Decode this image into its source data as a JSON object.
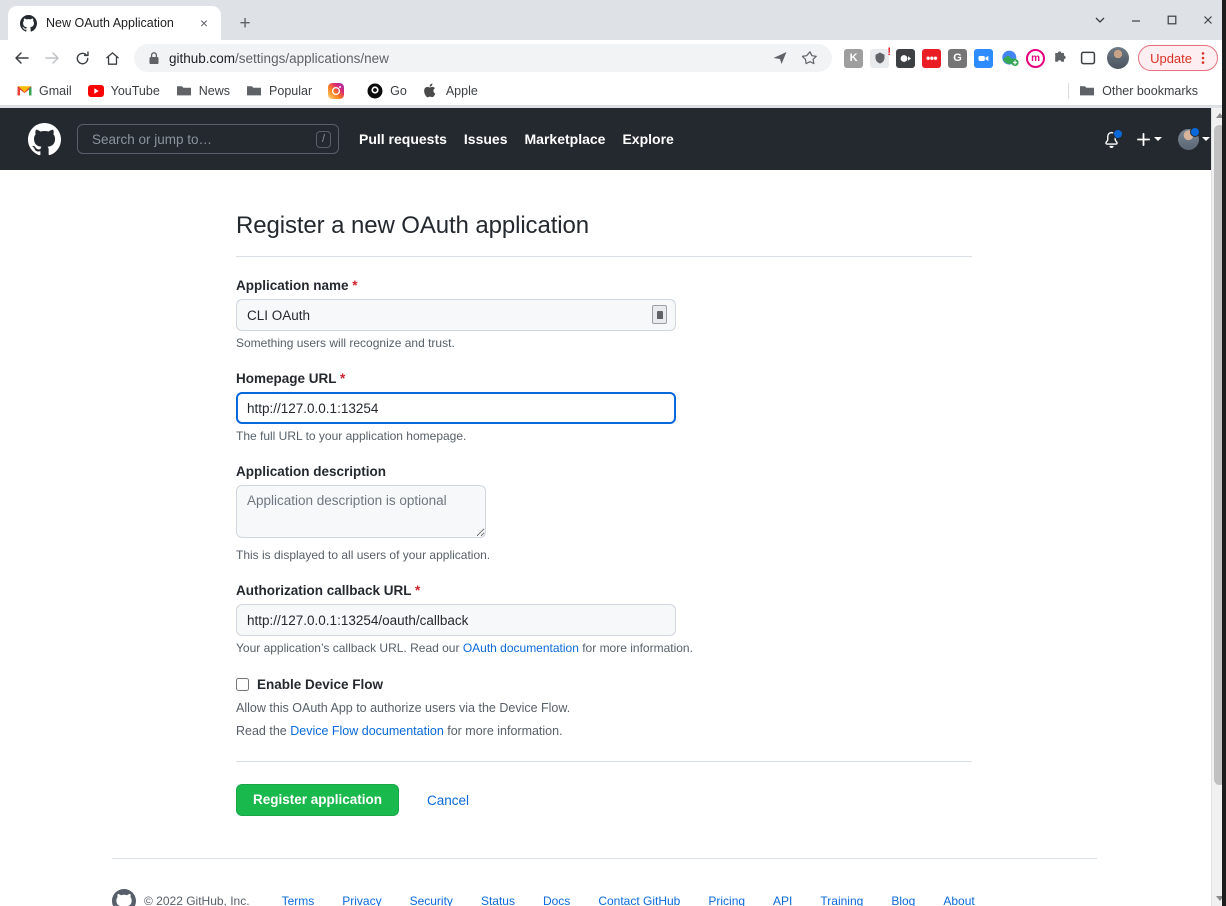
{
  "browser": {
    "tab": {
      "title": "New OAuth Application",
      "favicon": "github-icon",
      "close": "×"
    },
    "new_tab_label": "+",
    "window_controls": {
      "tab_search": "chevron-down-icon",
      "minimize": "minimize-icon",
      "maximize": "maximize-icon",
      "close": "close-icon"
    },
    "nav": {
      "back": "back-arrow-icon",
      "forward": "forward-arrow-icon",
      "reload": "reload-icon",
      "home": "home-icon"
    },
    "omnibox": {
      "lock": "lock-icon",
      "host": "github.com",
      "path": "/settings/applications/new",
      "share": "share-icon",
      "bookmark": "star-icon"
    },
    "extensions": [
      {
        "name": "kami-extension",
        "label": "K",
        "color": "#9e9e9e"
      },
      {
        "name": "grammar-extension",
        "label": "",
        "color": "#5f6368"
      },
      {
        "name": "screen-recorder-extension",
        "label": "",
        "color": "#3c4043"
      },
      {
        "name": "red-dots-extension",
        "label": "•••",
        "color": "#ea1c24"
      },
      {
        "name": "google-extension",
        "label": "G",
        "color": "#757575"
      },
      {
        "name": "zoom-extension",
        "label": "",
        "color": "#2d8cff"
      },
      {
        "name": "earth-extension",
        "label": "",
        "color": "#34a853"
      },
      {
        "name": "mattermost-extension",
        "label": "m",
        "color": "#e6007e"
      },
      {
        "name": "puzzle-extensions-icon",
        "label": "",
        "color": "#5f6368"
      },
      {
        "name": "sidepanel-icon",
        "label": "",
        "color": "#3c4043"
      }
    ],
    "update_button": "Update",
    "menu_icon": "three-dots-vertical-icon",
    "bookmarks": [
      {
        "name": "gmail",
        "label": "Gmail",
        "icon": "gmail-icon"
      },
      {
        "name": "youtube",
        "label": "YouTube",
        "icon": "youtube-icon"
      },
      {
        "name": "news",
        "label": "News",
        "icon": "folder-icon"
      },
      {
        "name": "popular",
        "label": "Popular",
        "icon": "folder-icon"
      },
      {
        "name": "instagram",
        "label": "",
        "icon": "instagram-icon"
      },
      {
        "name": "go",
        "label": "Go",
        "icon": "go-icon"
      },
      {
        "name": "apple",
        "label": "Apple",
        "icon": "apple-icon"
      }
    ],
    "other_bookmarks": "Other bookmarks"
  },
  "github_header": {
    "logo": "github-mark-icon",
    "search_placeholder": "Search or jump to…",
    "search_value": "",
    "slash_key": "/",
    "nav": [
      {
        "name": "pull-requests",
        "label": "Pull requests"
      },
      {
        "name": "issues",
        "label": "Issues"
      },
      {
        "name": "marketplace",
        "label": "Marketplace"
      },
      {
        "name": "explore",
        "label": "Explore"
      }
    ],
    "notifications_icon": "bell-icon",
    "create_new_icon": "plus-icon",
    "avatar": "user-avatar"
  },
  "page": {
    "title": "Register a new OAuth application",
    "fields": {
      "app_name": {
        "label": "Application name",
        "required": "*",
        "value": "CLI OAuth",
        "hint": "Something users will recognize and trust."
      },
      "homepage_url": {
        "label": "Homepage URL",
        "required": "*",
        "value": "http://127.0.0.1:13254",
        "hint": "The full URL to your application homepage."
      },
      "description": {
        "label": "Application description",
        "value": "",
        "placeholder": "Application description is optional",
        "hint": "This is displayed to all users of your application."
      },
      "callback_url": {
        "label": "Authorization callback URL",
        "required": "*",
        "value": "http://127.0.0.1:13254/oauth/callback",
        "hint_before": "Your application’s callback URL. Read our ",
        "hint_link": "OAuth documentation",
        "hint_after": " for more information."
      },
      "device_flow": {
        "label": "Enable Device Flow",
        "checked": false,
        "note1": "Allow this OAuth App to authorize users via the Device Flow.",
        "note2_before": "Read the ",
        "note2_link": "Device Flow documentation",
        "note2_after": " for more information."
      }
    },
    "actions": {
      "submit": "Register application",
      "cancel": "Cancel"
    }
  },
  "footer": {
    "logo": "github-mark-icon",
    "copyright": "© 2022 GitHub, Inc.",
    "links": [
      {
        "name": "terms",
        "label": "Terms"
      },
      {
        "name": "privacy",
        "label": "Privacy"
      },
      {
        "name": "security",
        "label": "Security"
      },
      {
        "name": "status",
        "label": "Status"
      },
      {
        "name": "docs",
        "label": "Docs"
      },
      {
        "name": "contact-github",
        "label": "Contact GitHub"
      },
      {
        "name": "pricing",
        "label": "Pricing"
      },
      {
        "name": "api",
        "label": "API"
      },
      {
        "name": "training",
        "label": "Training"
      },
      {
        "name": "blog",
        "label": "Blog"
      },
      {
        "name": "about",
        "label": "About"
      }
    ]
  },
  "colors": {
    "github_dark": "#24292f",
    "accent_blue": "#0969da",
    "success_green": "#1ab94d",
    "required_red": "#cf222e",
    "update_red": "#d93025"
  }
}
